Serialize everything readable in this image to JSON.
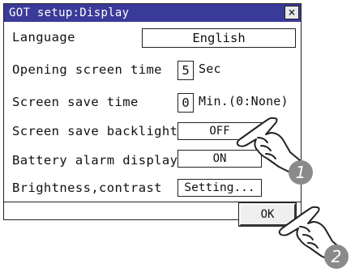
{
  "window": {
    "title": "GOT setup:Display",
    "close_label": "×"
  },
  "settings": {
    "language": {
      "label": "Language",
      "value": "English"
    },
    "opening_screen_time": {
      "label": "Opening screen time",
      "value": "5",
      "unit": "Sec"
    },
    "screen_save_time": {
      "label": "Screen save time",
      "value": "0",
      "unit": "Min.(0:None)"
    },
    "screen_save_backlight": {
      "label": "Screen save backlight",
      "value": "OFF"
    },
    "battery_alarm_display": {
      "label": "Battery alarm display",
      "value": "ON"
    },
    "brightness_contrast": {
      "label": "Brightness,contrast",
      "button": "Setting..."
    }
  },
  "footer": {
    "ok_label": "OK"
  },
  "annotations": {
    "step1": "1",
    "step2": "2"
  },
  "colors": {
    "titlebar": "#3a3a9a",
    "badge": "#8a8a8a"
  }
}
